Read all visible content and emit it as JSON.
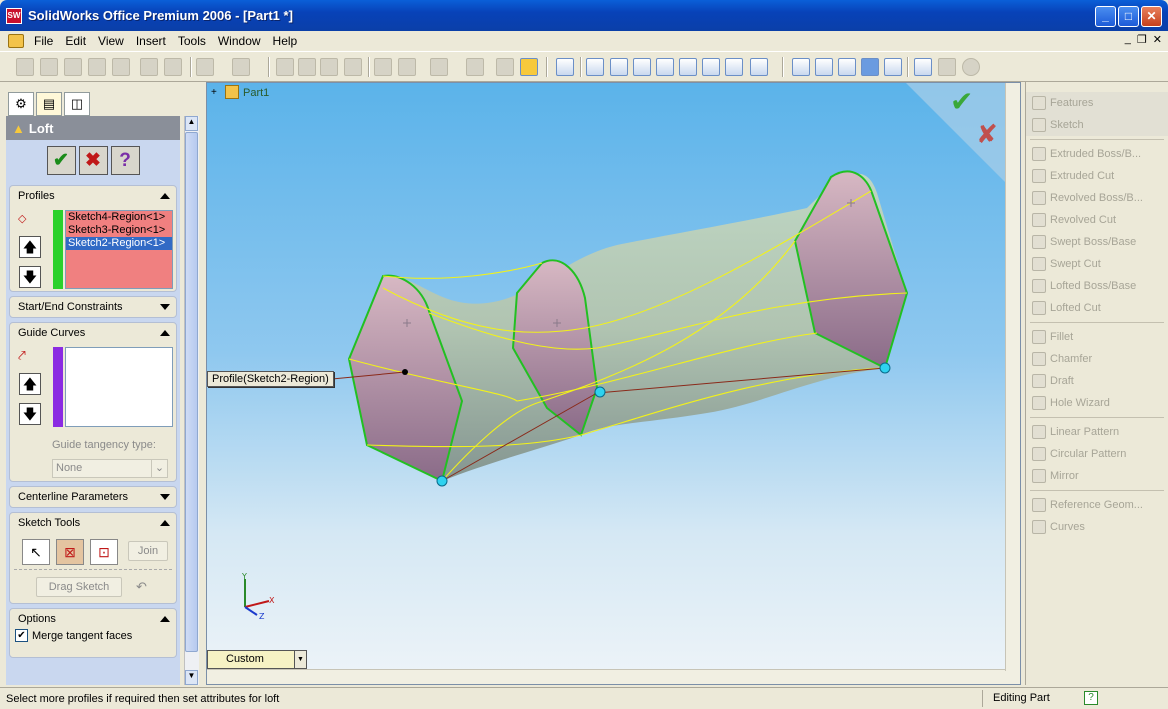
{
  "window": {
    "title": "SolidWorks Office Premium 2006 - [Part1 *]",
    "app_icon": "SW"
  },
  "menu": [
    "File",
    "Edit",
    "View",
    "Insert",
    "Tools",
    "Window",
    "Help"
  ],
  "property_manager": {
    "title": "Loft",
    "ok": "✔",
    "cancel": "✖",
    "help": "?",
    "profiles": {
      "header": "Profiles",
      "items": [
        "Sketch4-Region<1>",
        "Sketch3-Region<1>",
        "Sketch2-Region<1>"
      ],
      "selected_index": 2
    },
    "start_end_constraints": "Start/End Constraints",
    "guide_curves": {
      "header": "Guide Curves",
      "tangency_label": "Guide tangency type:",
      "tangency_value": "None"
    },
    "centerline_parameters": "Centerline Parameters",
    "sketch_tools": {
      "header": "Sketch Tools",
      "join": "Join",
      "drag_sketch": "Drag Sketch"
    },
    "options": {
      "header": "Options",
      "merge_tangent": "Merge tangent faces"
    }
  },
  "viewport": {
    "tree_root": "Part1",
    "callout": "Profile(Sketch2-Region)",
    "view_selector": "Custom",
    "accept_icon": "green-check-icon",
    "reject_icon": "red-x-icon",
    "triad": {
      "x": "X",
      "y": "Y",
      "z": "Z"
    }
  },
  "task_pane": {
    "tabs": [
      "Features",
      "Sketch"
    ],
    "tools": [
      "Extruded Boss/B...",
      "Extruded Cut",
      "Revolved Boss/B...",
      "Revolved Cut",
      "Swept Boss/Base",
      "Swept Cut",
      "Lofted Boss/Base",
      "Lofted Cut"
    ],
    "tools2": [
      "Fillet",
      "Chamfer",
      "Draft",
      "Hole Wizard"
    ],
    "tools3": [
      "Linear Pattern",
      "Circular Pattern",
      "Mirror"
    ],
    "tools4": [
      "Reference Geom...",
      "Curves"
    ]
  },
  "status": {
    "message": "Select more profiles if required then set attributes for loft",
    "mode": "Editing Part"
  },
  "colors": {
    "selected": "#316ac5",
    "profile_bg": "#f08080",
    "profile_bar": "#2bd12b",
    "guide_bar": "#8b2be2",
    "edge_green": "#22c022",
    "guide_yellow": "#f2f21a"
  }
}
